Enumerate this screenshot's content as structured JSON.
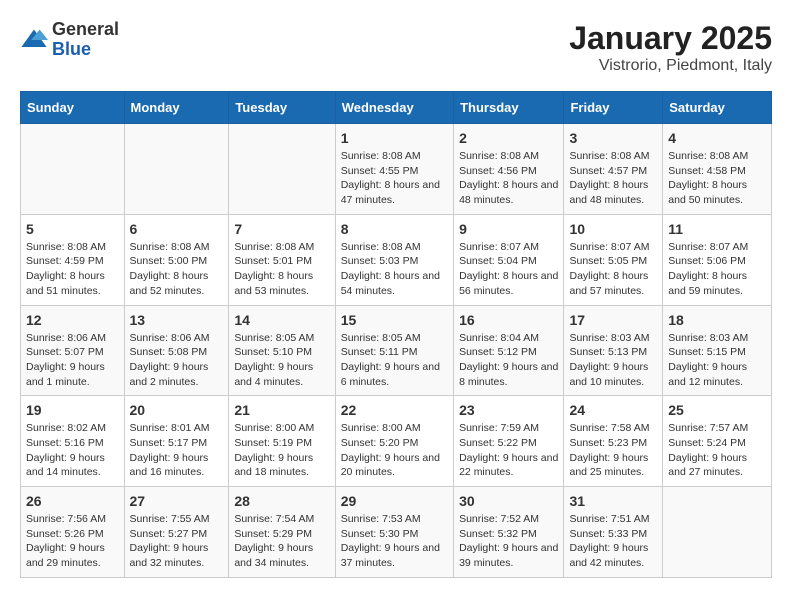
{
  "header": {
    "logo_general": "General",
    "logo_blue": "Blue",
    "title": "January 2025",
    "subtitle": "Vistrorio, Piedmont, Italy"
  },
  "weekdays": [
    "Sunday",
    "Monday",
    "Tuesday",
    "Wednesday",
    "Thursday",
    "Friday",
    "Saturday"
  ],
  "weeks": [
    [
      {
        "day": "",
        "info": ""
      },
      {
        "day": "",
        "info": ""
      },
      {
        "day": "",
        "info": ""
      },
      {
        "day": "1",
        "info": "Sunrise: 8:08 AM\nSunset: 4:55 PM\nDaylight: 8 hours and 47 minutes."
      },
      {
        "day": "2",
        "info": "Sunrise: 8:08 AM\nSunset: 4:56 PM\nDaylight: 8 hours and 48 minutes."
      },
      {
        "day": "3",
        "info": "Sunrise: 8:08 AM\nSunset: 4:57 PM\nDaylight: 8 hours and 48 minutes."
      },
      {
        "day": "4",
        "info": "Sunrise: 8:08 AM\nSunset: 4:58 PM\nDaylight: 8 hours and 50 minutes."
      }
    ],
    [
      {
        "day": "5",
        "info": "Sunrise: 8:08 AM\nSunset: 4:59 PM\nDaylight: 8 hours and 51 minutes."
      },
      {
        "day": "6",
        "info": "Sunrise: 8:08 AM\nSunset: 5:00 PM\nDaylight: 8 hours and 52 minutes."
      },
      {
        "day": "7",
        "info": "Sunrise: 8:08 AM\nSunset: 5:01 PM\nDaylight: 8 hours and 53 minutes."
      },
      {
        "day": "8",
        "info": "Sunrise: 8:08 AM\nSunset: 5:03 PM\nDaylight: 8 hours and 54 minutes."
      },
      {
        "day": "9",
        "info": "Sunrise: 8:07 AM\nSunset: 5:04 PM\nDaylight: 8 hours and 56 minutes."
      },
      {
        "day": "10",
        "info": "Sunrise: 8:07 AM\nSunset: 5:05 PM\nDaylight: 8 hours and 57 minutes."
      },
      {
        "day": "11",
        "info": "Sunrise: 8:07 AM\nSunset: 5:06 PM\nDaylight: 8 hours and 59 minutes."
      }
    ],
    [
      {
        "day": "12",
        "info": "Sunrise: 8:06 AM\nSunset: 5:07 PM\nDaylight: 9 hours and 1 minute."
      },
      {
        "day": "13",
        "info": "Sunrise: 8:06 AM\nSunset: 5:08 PM\nDaylight: 9 hours and 2 minutes."
      },
      {
        "day": "14",
        "info": "Sunrise: 8:05 AM\nSunset: 5:10 PM\nDaylight: 9 hours and 4 minutes."
      },
      {
        "day": "15",
        "info": "Sunrise: 8:05 AM\nSunset: 5:11 PM\nDaylight: 9 hours and 6 minutes."
      },
      {
        "day": "16",
        "info": "Sunrise: 8:04 AM\nSunset: 5:12 PM\nDaylight: 9 hours and 8 minutes."
      },
      {
        "day": "17",
        "info": "Sunrise: 8:03 AM\nSunset: 5:13 PM\nDaylight: 9 hours and 10 minutes."
      },
      {
        "day": "18",
        "info": "Sunrise: 8:03 AM\nSunset: 5:15 PM\nDaylight: 9 hours and 12 minutes."
      }
    ],
    [
      {
        "day": "19",
        "info": "Sunrise: 8:02 AM\nSunset: 5:16 PM\nDaylight: 9 hours and 14 minutes."
      },
      {
        "day": "20",
        "info": "Sunrise: 8:01 AM\nSunset: 5:17 PM\nDaylight: 9 hours and 16 minutes."
      },
      {
        "day": "21",
        "info": "Sunrise: 8:00 AM\nSunset: 5:19 PM\nDaylight: 9 hours and 18 minutes."
      },
      {
        "day": "22",
        "info": "Sunrise: 8:00 AM\nSunset: 5:20 PM\nDaylight: 9 hours and 20 minutes."
      },
      {
        "day": "23",
        "info": "Sunrise: 7:59 AM\nSunset: 5:22 PM\nDaylight: 9 hours and 22 minutes."
      },
      {
        "day": "24",
        "info": "Sunrise: 7:58 AM\nSunset: 5:23 PM\nDaylight: 9 hours and 25 minutes."
      },
      {
        "day": "25",
        "info": "Sunrise: 7:57 AM\nSunset: 5:24 PM\nDaylight: 9 hours and 27 minutes."
      }
    ],
    [
      {
        "day": "26",
        "info": "Sunrise: 7:56 AM\nSunset: 5:26 PM\nDaylight: 9 hours and 29 minutes."
      },
      {
        "day": "27",
        "info": "Sunrise: 7:55 AM\nSunset: 5:27 PM\nDaylight: 9 hours and 32 minutes."
      },
      {
        "day": "28",
        "info": "Sunrise: 7:54 AM\nSunset: 5:29 PM\nDaylight: 9 hours and 34 minutes."
      },
      {
        "day": "29",
        "info": "Sunrise: 7:53 AM\nSunset: 5:30 PM\nDaylight: 9 hours and 37 minutes."
      },
      {
        "day": "30",
        "info": "Sunrise: 7:52 AM\nSunset: 5:32 PM\nDaylight: 9 hours and 39 minutes."
      },
      {
        "day": "31",
        "info": "Sunrise: 7:51 AM\nSunset: 5:33 PM\nDaylight: 9 hours and 42 minutes."
      },
      {
        "day": "",
        "info": ""
      }
    ]
  ]
}
